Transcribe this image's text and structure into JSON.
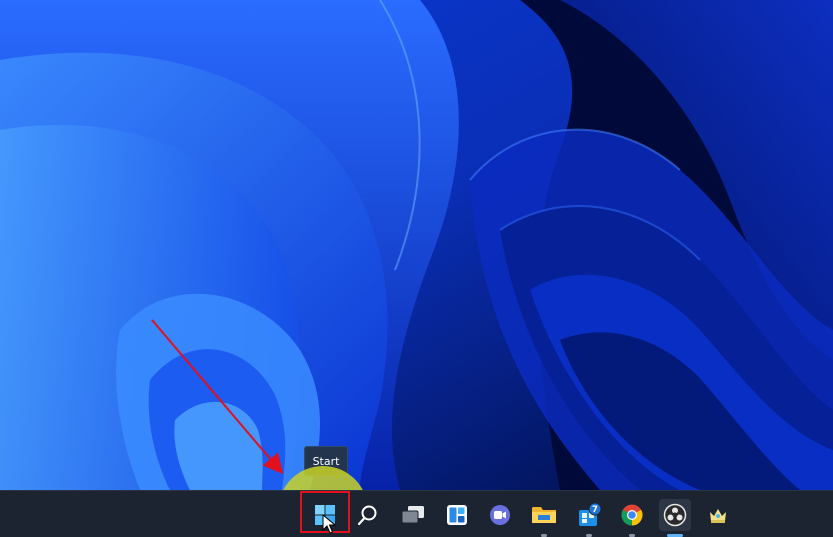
{
  "tooltip": {
    "text": "Start"
  },
  "taskbar": {
    "items": [
      {
        "name": "start-button",
        "icon": "windows-logo-icon"
      },
      {
        "name": "search-button",
        "icon": "search-icon"
      },
      {
        "name": "task-view-button",
        "icon": "task-view-icon"
      },
      {
        "name": "widgets-button",
        "icon": "widgets-icon"
      },
      {
        "name": "chat-button",
        "icon": "teams-chat-icon"
      },
      {
        "name": "file-explorer-button",
        "icon": "folder-icon"
      },
      {
        "name": "store-button",
        "icon": "store-icon",
        "badge": "7"
      },
      {
        "name": "chrome-button",
        "icon": "chrome-icon"
      },
      {
        "name": "obs-button",
        "icon": "obs-icon"
      },
      {
        "name": "app-button",
        "icon": "crown-app-icon"
      }
    ]
  },
  "colors": {
    "taskbar": "#1b2430",
    "highlight": "#c8d228",
    "annotation": "#e0101c",
    "wallpaper_dark": "#000a3a",
    "wallpaper_bright": "#2f6bff"
  }
}
